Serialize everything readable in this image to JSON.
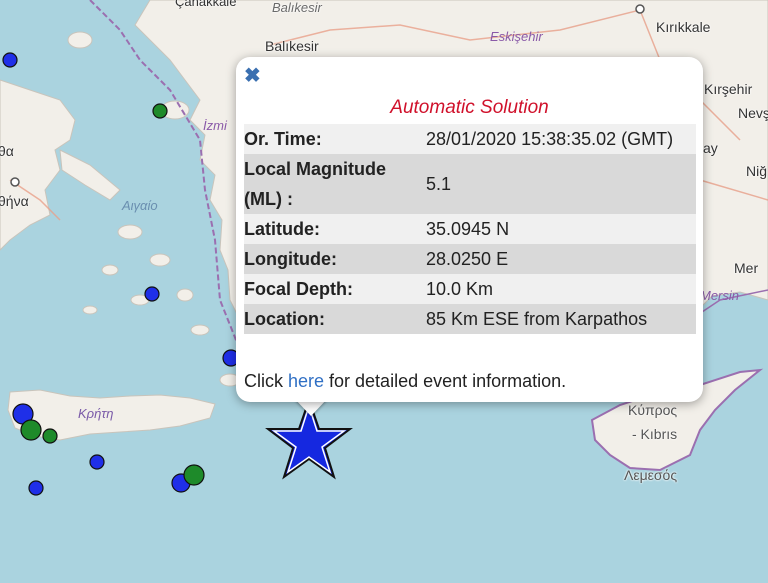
{
  "map": {
    "labels": {
      "balikesir_top": "Balıkesir",
      "balikesir": "Balıkesir",
      "canakkale": "Çanakkale",
      "eskisehir": "Eskişehir",
      "kirikkale": "Kırıkkale",
      "kirsehir": "Kırşehir",
      "nevsehir": "Nevş",
      "nig": "Niğ",
      "izmir": "İzmi",
      "ay": "ay",
      "athina_top": "θα",
      "athina": "θήνα",
      "aigaio": "Αιγαίο",
      "kriti": "Κρήτη",
      "mer": "Mer",
      "mersin": "Mersin",
      "kypros": "Κύπρος",
      "kibris": "- Kıbrıs",
      "lemesos": "Λεμεσός"
    },
    "colors": {
      "sea": "#aad3df",
      "land": "#f2efe9",
      "border": "#9b6fb0",
      "event_blue": "#1f2fe8",
      "event_green": "#1e8a2a",
      "star": "#1528e0"
    }
  },
  "popup": {
    "close_icon": "close-icon",
    "title": "Automatic Solution",
    "rows": [
      {
        "label": "Or. Time:",
        "value": "28/01/2020 15:38:35.02 (GMT)"
      },
      {
        "label": "Local Magnitude (ML) :",
        "value": "5.1"
      },
      {
        "label": "Latitude:",
        "value": "35.0945 N"
      },
      {
        "label": "Longitude:",
        "value": "28.0250 E"
      },
      {
        "label": "Focal Depth:",
        "value": "10.0 Km"
      },
      {
        "label": "Location:",
        "value": "85 Km ESE from Karpathos"
      }
    ],
    "footer_prefix": "Click ",
    "footer_link": "here",
    "footer_suffix": " for detailed event information."
  }
}
